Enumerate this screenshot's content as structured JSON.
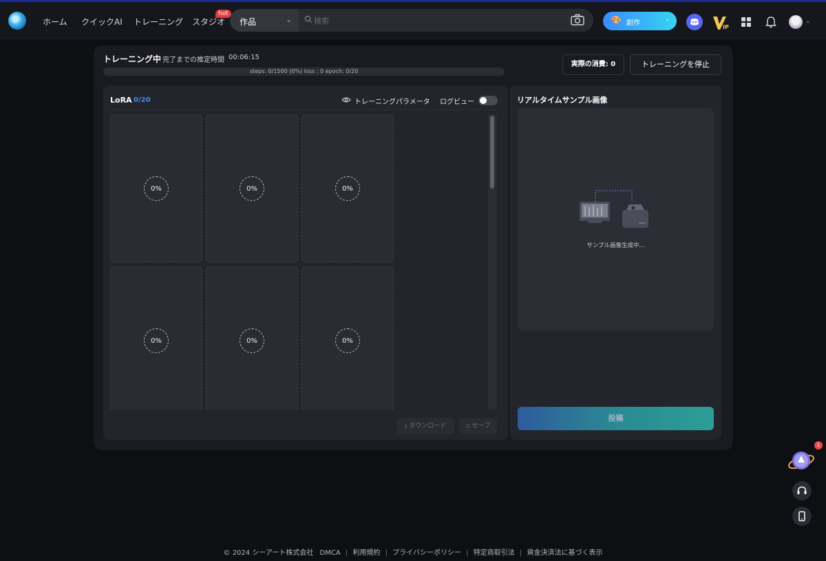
{
  "nav": {
    "items": [
      {
        "label": "ホーム"
      },
      {
        "label": "クイックAI"
      },
      {
        "label": "トレーニング"
      },
      {
        "label": "スタジオ"
      }
    ],
    "hot_badge": "hot"
  },
  "search": {
    "category": "作品",
    "placeholder": "検索"
  },
  "create_button": {
    "label": "創作"
  },
  "icons": {
    "logo": "app-logo",
    "camera": "camera-icon",
    "discord": "discord-icon",
    "vip": "vip-icon",
    "apps": "apps-grid-icon",
    "bell": "bell-icon",
    "eye": "eye-icon"
  },
  "colors": {
    "accent_blue": "#3d8cf5",
    "progress": "#3a66d6",
    "create_gradient_start": "#3b8cff",
    "create_gradient_end": "#36d4f0"
  },
  "training": {
    "status": "トレーニング中",
    "eta_label": "完了までの推定時間",
    "eta_time": "00:06:15",
    "progress_fraction": 0,
    "progress_text": "steps: 0/1500 (0%) loss : 0 epoch: 0/20",
    "cost_label": "実際の消費: 0",
    "stop_label": "トレーニングを停止"
  },
  "lora": {
    "title": "LoRA",
    "count": "0/20",
    "params_label": "トレーニングパラメータ",
    "log_view_label": "ログビュー",
    "log_view_on": false,
    "cards": [
      "0%",
      "0%",
      "0%",
      "0%",
      "0%",
      "0%"
    ],
    "download_label": "ダウンロード",
    "save_label": "セーブ"
  },
  "realtime": {
    "title": "リアルタイムサンプル画像",
    "generating_text": "サンプル画像生成中...",
    "post_label": "投稿"
  },
  "floating": {
    "notification_count": "1"
  },
  "footer": {
    "copyright": "© 2024 シーアート株式会社",
    "links": [
      "DMCA",
      "利用規約",
      "プライバシーポリシー",
      "特定商取引法",
      "資金決済法に基づく表示"
    ]
  }
}
